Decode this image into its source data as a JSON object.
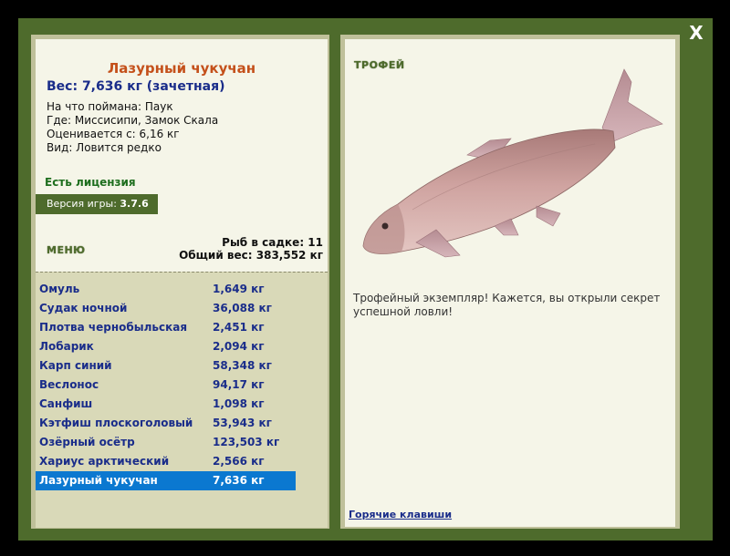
{
  "window": {
    "close_label": "X"
  },
  "fish": {
    "name": "Лазурный чукучан",
    "weight_line": "Вес: 7,636 кг (зачетная)",
    "bait": "На что поймана: Паук",
    "location": "Где: Миссисипи, Замок Скала",
    "valued_from": "Оценивается с: 6,16 кг",
    "kind": "Вид: Ловится редко"
  },
  "license": "Есть лицензия",
  "version": {
    "label": "Версия игры: ",
    "value": "3.7.6"
  },
  "menu_label": "МЕНЮ",
  "stats": {
    "fish_in_keepnet": "Рыб в садке: 11",
    "total_weight": "Общий вес: 383,552 кг"
  },
  "catch_list": [
    {
      "name": "Омуль",
      "weight": "1,649 кг"
    },
    {
      "name": "Судак ночной",
      "weight": "36,088 кг"
    },
    {
      "name": "Плотва чернобыльская",
      "weight": "2,451 кг"
    },
    {
      "name": "Лобарик",
      "weight": "2,094 кг"
    },
    {
      "name": "Карп синий",
      "weight": "58,348 кг"
    },
    {
      "name": "Веслонос",
      "weight": "94,17 кг"
    },
    {
      "name": "Санфиш",
      "weight": "1,098 кг"
    },
    {
      "name": "Кэтфиш плоскоголовый",
      "weight": "53,943 кг"
    },
    {
      "name": "Озёрный осётр",
      "weight": "123,503 кг"
    },
    {
      "name": "Хариус арктический",
      "weight": "2,566 кг"
    },
    {
      "name": "Лазурный чукучан",
      "weight": "7,636 кг"
    }
  ],
  "selected_index": 10,
  "trophy": {
    "label": "ТРОФЕЙ",
    "description": "Трофейный экземпляр! Кажется, вы открыли секрет успешной ловли!"
  },
  "hotkeys_label": "Горячие клавиши",
  "colors": {
    "frame": "#4e6b2c",
    "selected_row": "#0b78d0",
    "fish_name": "#c4501a",
    "list_text": "#1a2d8a"
  }
}
